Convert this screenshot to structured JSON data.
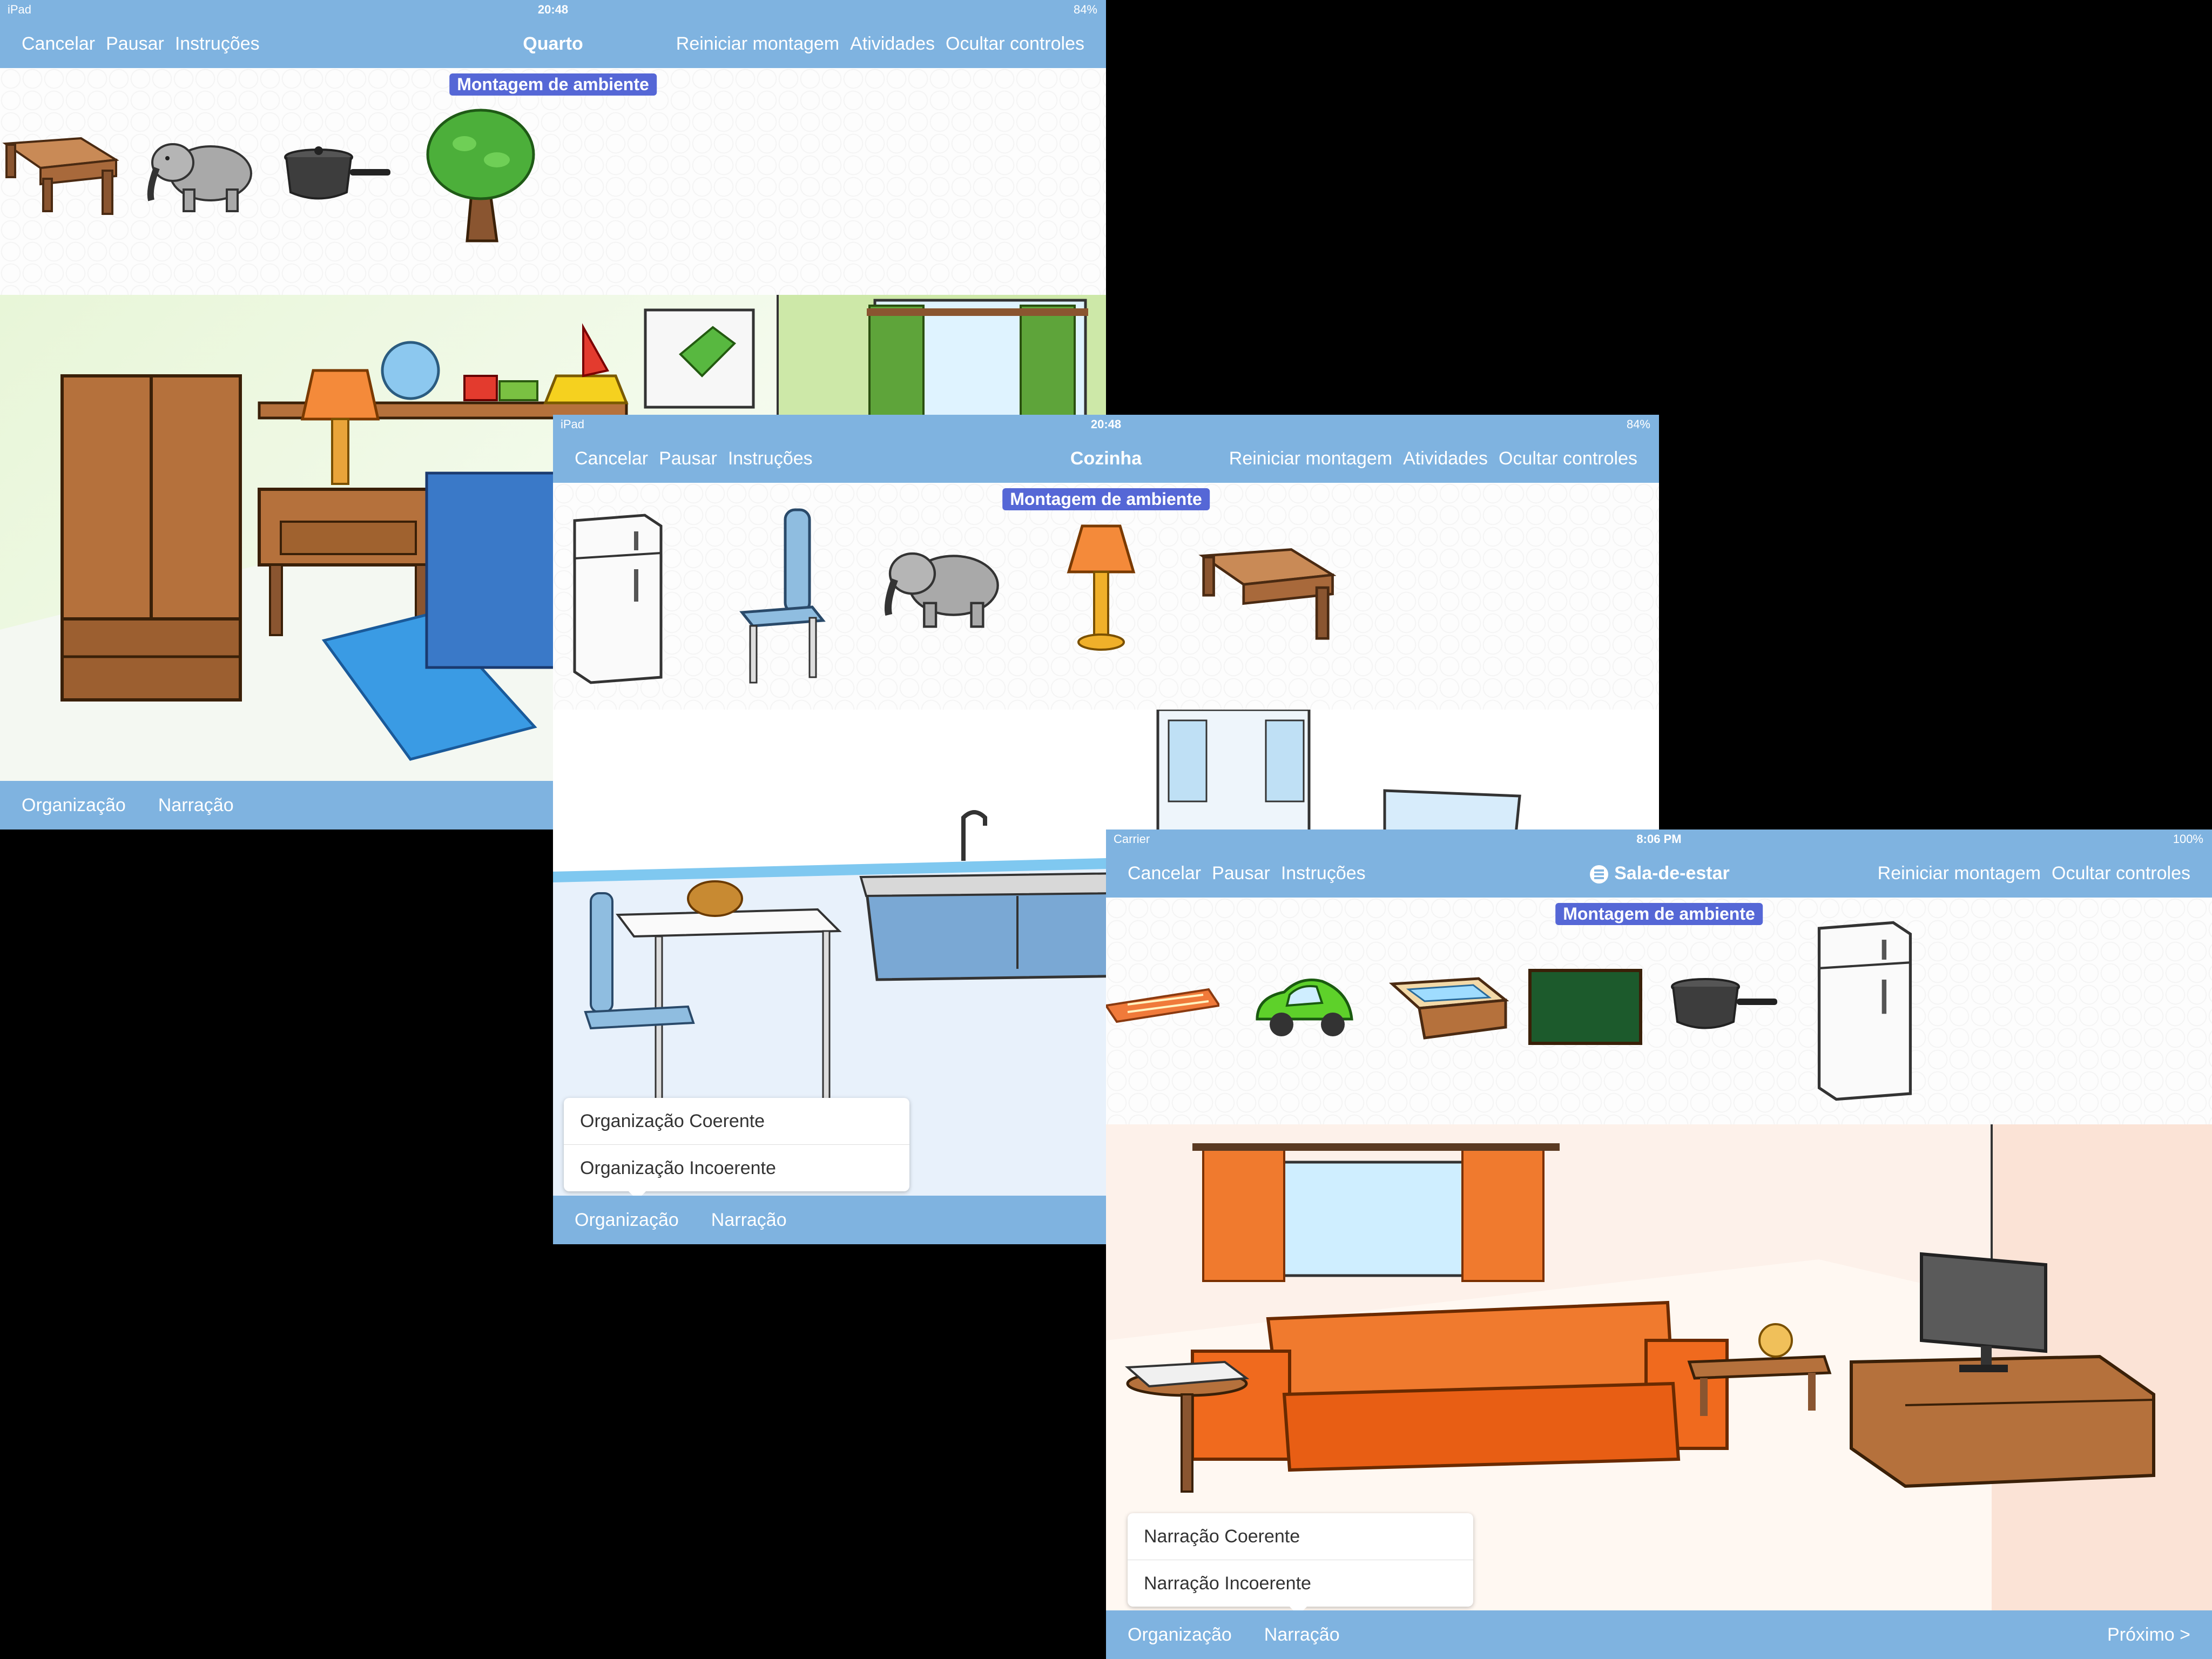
{
  "colors": {
    "bar": "#7fb3e0",
    "badge": "#5567d6",
    "background": "#000000"
  },
  "screens": [
    {
      "status": {
        "left": "iPad",
        "time": "20:48",
        "battery": "84%"
      },
      "nav": {
        "cancel": "Cancelar",
        "pause": "Pausar",
        "instructions": "Instruções",
        "title": "Quarto",
        "restart": "Reiniciar montagem",
        "activities": "Atividades",
        "hide": "Ocultar controles"
      },
      "badge": "Montagem de ambiente",
      "palette_items": [
        "desk-icon",
        "elephant-icon",
        "pot-icon",
        "tree-icon"
      ],
      "bottom": {
        "organization": "Organização",
        "narration": "Narração"
      }
    },
    {
      "status": {
        "left": "iPad",
        "time": "20:48",
        "battery": "84%"
      },
      "nav": {
        "cancel": "Cancelar",
        "pause": "Pausar",
        "instructions": "Instruções",
        "title": "Cozinha",
        "restart": "Reiniciar montagem",
        "activities": "Atividades",
        "hide": "Ocultar controles"
      },
      "badge": "Montagem de ambiente",
      "palette_items": [
        "fridge-icon",
        "chair-icon",
        "elephant-icon",
        "lamp-icon",
        "desk-icon"
      ],
      "popup": {
        "option1": "Organização Coerente",
        "option2": "Organização Incoerente"
      },
      "bottom": {
        "organization": "Organização",
        "narration": "Narração"
      }
    },
    {
      "status": {
        "left": "Carrier",
        "time": "8:06 PM",
        "battery": "100%"
      },
      "nav": {
        "cancel": "Cancelar",
        "pause": "Pausar",
        "instructions": "Instruções",
        "title": "Sala-de-estar",
        "restart": "Reiniciar montagem",
        "hide": "Ocultar controles"
      },
      "badge": "Montagem de ambiente",
      "palette_items": [
        "rug-icon",
        "toy-car-icon",
        "table-icon",
        "chalkboard-icon",
        "pot-icon",
        "fridge-icon"
      ],
      "popup": {
        "option1": "Narração Coerente",
        "option2": "Narração Incoerente"
      },
      "bottom": {
        "organization": "Organização",
        "narration": "Narração",
        "next": "Próximo >"
      }
    }
  ]
}
